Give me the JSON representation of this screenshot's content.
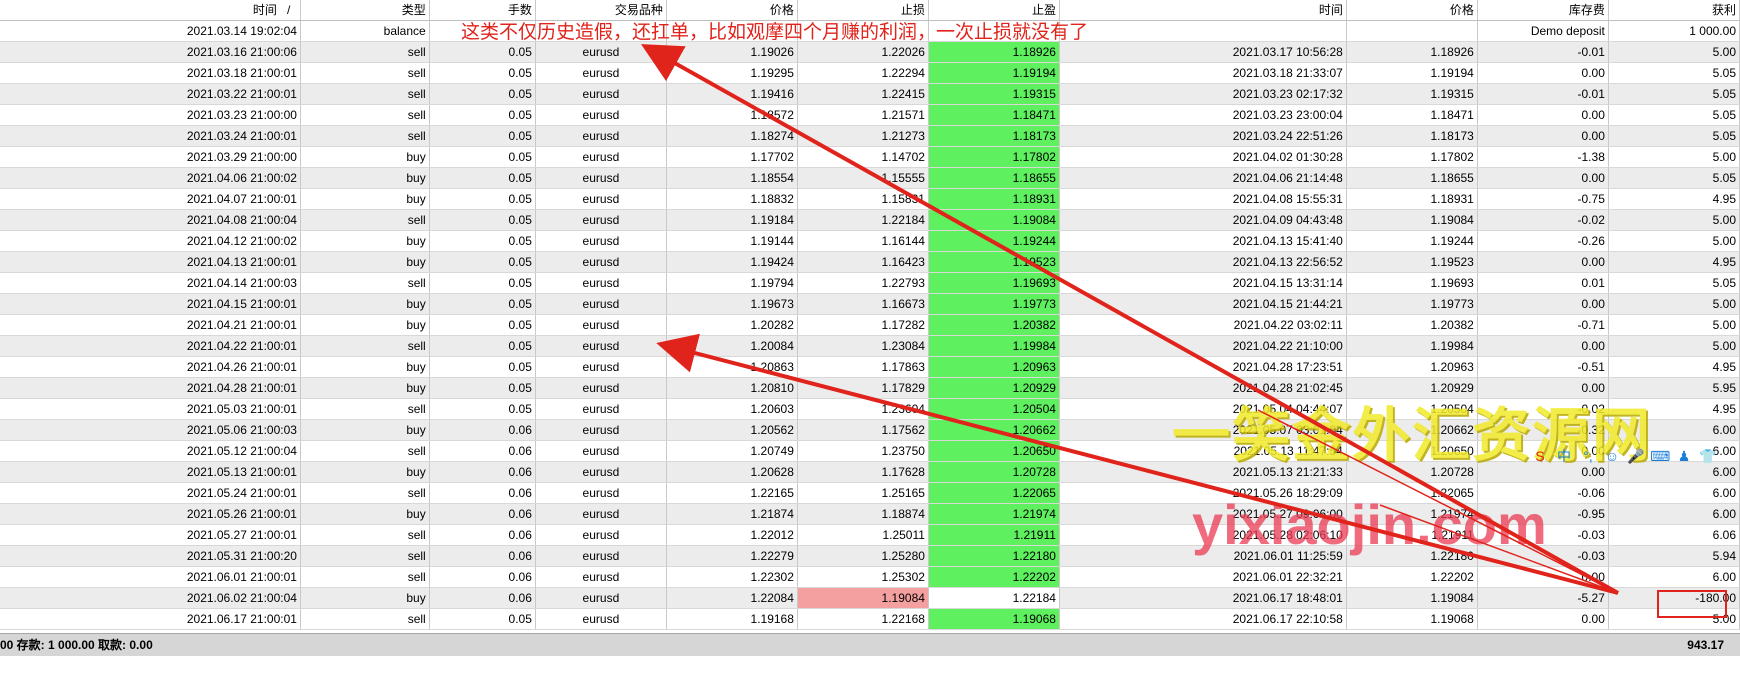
{
  "columns": [
    "时间",
    "类型",
    "手数",
    "交易品种",
    "价格",
    "止损",
    "止盈",
    "时间",
    "价格",
    "库存费",
    "获利"
  ],
  "sort_indicator": "/",
  "rows": [
    {
      "open_time": "2021.03.14 19:02:04",
      "type": "balance",
      "lots": "",
      "symbol": "",
      "open_price": "",
      "sl": "",
      "tp": "",
      "close_time": "",
      "close_price": "",
      "swap": "Demo deposit",
      "profit": "1 000.00"
    },
    {
      "open_time": "2021.03.16 21:00:06",
      "type": "sell",
      "lots": "0.05",
      "symbol": "eurusd",
      "open_price": "1.19026",
      "sl": "1.22026",
      "tp": "1.18926",
      "close_time": "2021.03.17 10:56:28",
      "close_price": "1.18926",
      "swap": "-0.01",
      "profit": "5.00"
    },
    {
      "open_time": "2021.03.18 21:00:01",
      "type": "sell",
      "lots": "0.05",
      "symbol": "eurusd",
      "open_price": "1.19295",
      "sl": "1.22294",
      "tp": "1.19194",
      "close_time": "2021.03.18 21:33:07",
      "close_price": "1.19194",
      "swap": "0.00",
      "profit": "5.05"
    },
    {
      "open_time": "2021.03.22 21:00:01",
      "type": "sell",
      "lots": "0.05",
      "symbol": "eurusd",
      "open_price": "1.19416",
      "sl": "1.22415",
      "tp": "1.19315",
      "close_time": "2021.03.23 02:17:32",
      "close_price": "1.19315",
      "swap": "-0.01",
      "profit": "5.05"
    },
    {
      "open_time": "2021.03.23 21:00:00",
      "type": "sell",
      "lots": "0.05",
      "symbol": "eurusd",
      "open_price": "1.18572",
      "sl": "1.21571",
      "tp": "1.18471",
      "close_time": "2021.03.23 23:00:04",
      "close_price": "1.18471",
      "swap": "0.00",
      "profit": "5.05"
    },
    {
      "open_time": "2021.03.24 21:00:01",
      "type": "sell",
      "lots": "0.05",
      "symbol": "eurusd",
      "open_price": "1.18274",
      "sl": "1.21273",
      "tp": "1.18173",
      "close_time": "2021.03.24 22:51:26",
      "close_price": "1.18173",
      "swap": "0.00",
      "profit": "5.05"
    },
    {
      "open_time": "2021.03.29 21:00:00",
      "type": "buy",
      "lots": "0.05",
      "symbol": "eurusd",
      "open_price": "1.17702",
      "sl": "1.14702",
      "tp": "1.17802",
      "close_time": "2021.04.02 01:30:28",
      "close_price": "1.17802",
      "swap": "-1.38",
      "profit": "5.00"
    },
    {
      "open_time": "2021.04.06 21:00:02",
      "type": "buy",
      "lots": "0.05",
      "symbol": "eurusd",
      "open_price": "1.18554",
      "sl": "1.15555",
      "tp": "1.18655",
      "close_time": "2021.04.06 21:14:48",
      "close_price": "1.18655",
      "swap": "0.00",
      "profit": "5.05"
    },
    {
      "open_time": "2021.04.07 21:00:01",
      "type": "buy",
      "lots": "0.05",
      "symbol": "eurusd",
      "open_price": "1.18832",
      "sl": "1.15831",
      "tp": "1.18931",
      "close_time": "2021.04.08 15:55:31",
      "close_price": "1.18931",
      "swap": "-0.75",
      "profit": "4.95"
    },
    {
      "open_time": "2021.04.08 21:00:04",
      "type": "sell",
      "lots": "0.05",
      "symbol": "eurusd",
      "open_price": "1.19184",
      "sl": "1.22184",
      "tp": "1.19084",
      "close_time": "2021.04.09 04:43:48",
      "close_price": "1.19084",
      "swap": "-0.02",
      "profit": "5.00"
    },
    {
      "open_time": "2021.04.12 21:00:02",
      "type": "buy",
      "lots": "0.05",
      "symbol": "eurusd",
      "open_price": "1.19144",
      "sl": "1.16144",
      "tp": "1.19244",
      "close_time": "2021.04.13 15:41:40",
      "close_price": "1.19244",
      "swap": "-0.26",
      "profit": "5.00"
    },
    {
      "open_time": "2021.04.13 21:00:01",
      "type": "buy",
      "lots": "0.05",
      "symbol": "eurusd",
      "open_price": "1.19424",
      "sl": "1.16423",
      "tp": "1.19523",
      "close_time": "2021.04.13 22:56:52",
      "close_price": "1.19523",
      "swap": "0.00",
      "profit": "4.95"
    },
    {
      "open_time": "2021.04.14 21:00:03",
      "type": "sell",
      "lots": "0.05",
      "symbol": "eurusd",
      "open_price": "1.19794",
      "sl": "1.22793",
      "tp": "1.19693",
      "close_time": "2021.04.15 13:31:14",
      "close_price": "1.19693",
      "swap": "0.01",
      "profit": "5.05"
    },
    {
      "open_time": "2021.04.15 21:00:01",
      "type": "buy",
      "lots": "0.05",
      "symbol": "eurusd",
      "open_price": "1.19673",
      "sl": "1.16673",
      "tp": "1.19773",
      "close_time": "2021.04.15 21:44:21",
      "close_price": "1.19773",
      "swap": "0.00",
      "profit": "5.00"
    },
    {
      "open_time": "2021.04.21 21:00:01",
      "type": "buy",
      "lots": "0.05",
      "symbol": "eurusd",
      "open_price": "1.20282",
      "sl": "1.17282",
      "tp": "1.20382",
      "close_time": "2021.04.22 03:02:11",
      "close_price": "1.20382",
      "swap": "-0.71",
      "profit": "5.00"
    },
    {
      "open_time": "2021.04.22 21:00:01",
      "type": "sell",
      "lots": "0.05",
      "symbol": "eurusd",
      "open_price": "1.20084",
      "sl": "1.23084",
      "tp": "1.19984",
      "close_time": "2021.04.22 21:10:00",
      "close_price": "1.19984",
      "swap": "0.00",
      "profit": "5.00"
    },
    {
      "open_time": "2021.04.26 21:00:01",
      "type": "buy",
      "lots": "0.05",
      "symbol": "eurusd",
      "open_price": "1.20863",
      "sl": "1.17863",
      "tp": "1.20963",
      "close_time": "2021.04.28 17:23:51",
      "close_price": "1.20963",
      "swap": "-0.51",
      "profit": "4.95"
    },
    {
      "open_time": "2021.04.28 21:00:01",
      "type": "buy",
      "lots": "0.05",
      "symbol": "eurusd",
      "open_price": "1.20810",
      "sl": "1.17829",
      "tp": "1.20929",
      "close_time": "2021.04.28 21:02:45",
      "close_price": "1.20929",
      "swap": "0.00",
      "profit": "5.95"
    },
    {
      "open_time": "2021.05.03 21:00:01",
      "type": "sell",
      "lots": "0.05",
      "symbol": "eurusd",
      "open_price": "1.20603",
      "sl": "1.23604",
      "tp": "1.20504",
      "close_time": "2021.05.04 04:44:07",
      "close_price": "1.20504",
      "swap": "-0.02",
      "profit": "4.95"
    },
    {
      "open_time": "2021.05.06 21:00:03",
      "type": "buy",
      "lots": "0.06",
      "symbol": "eurusd",
      "open_price": "1.20562",
      "sl": "1.17562",
      "tp": "1.20662",
      "close_time": "2021.05.07 03:01:04",
      "close_price": "1.20662",
      "swap": "-0.32",
      "profit": "6.00"
    },
    {
      "open_time": "2021.05.12 21:00:04",
      "type": "sell",
      "lots": "0.06",
      "symbol": "eurusd",
      "open_price": "1.20749",
      "sl": "1.23750",
      "tp": "1.20650",
      "close_time": "2021.05.13 11:47:54",
      "close_price": "1.20650",
      "swap": "0.00",
      "profit": "6.00"
    },
    {
      "open_time": "2021.05.13 21:00:01",
      "type": "buy",
      "lots": "0.06",
      "symbol": "eurusd",
      "open_price": "1.20628",
      "sl": "1.17628",
      "tp": "1.20728",
      "close_time": "2021.05.13 21:21:33",
      "close_price": "1.20728",
      "swap": "0.00",
      "profit": "6.00"
    },
    {
      "open_time": "2021.05.24 21:00:01",
      "type": "sell",
      "lots": "0.06",
      "symbol": "eurusd",
      "open_price": "1.22165",
      "sl": "1.25165",
      "tp": "1.22065",
      "close_time": "2021.05.26 18:29:09",
      "close_price": "1.22065",
      "swap": "-0.06",
      "profit": "6.00"
    },
    {
      "open_time": "2021.05.26 21:00:01",
      "type": "buy",
      "lots": "0.06",
      "symbol": "eurusd",
      "open_price": "1.21874",
      "sl": "1.18874",
      "tp": "1.21974",
      "close_time": "2021.05.27 09:06:00",
      "close_price": "1.21974",
      "swap": "-0.95",
      "profit": "6.00"
    },
    {
      "open_time": "2021.05.27 21:00:01",
      "type": "sell",
      "lots": "0.06",
      "symbol": "eurusd",
      "open_price": "1.22012",
      "sl": "1.25011",
      "tp": "1.21911",
      "close_time": "2021.05.28 02:06:10",
      "close_price": "1.21911",
      "swap": "-0.03",
      "profit": "6.06"
    },
    {
      "open_time": "2021.05.31 21:00:20",
      "type": "sell",
      "lots": "0.06",
      "symbol": "eurusd",
      "open_price": "1.22279",
      "sl": "1.25280",
      "tp": "1.22180",
      "close_time": "2021.06.01 11:25:59",
      "close_price": "1.22180",
      "swap": "-0.03",
      "profit": "5.94"
    },
    {
      "open_time": "2021.06.01 21:00:01",
      "type": "sell",
      "lots": "0.06",
      "symbol": "eurusd",
      "open_price": "1.22302",
      "sl": "1.25302",
      "tp": "1.22202",
      "close_time": "2021.06.01 22:32:21",
      "close_price": "1.22202",
      "swap": "0.00",
      "profit": "6.00"
    },
    {
      "open_time": "2021.06.02 21:00:04",
      "type": "buy",
      "lots": "0.06",
      "symbol": "eurusd",
      "open_price": "1.22084",
      "sl": "1.19084",
      "tp": "1.22184",
      "close_time": "2021.06.17 18:48:01",
      "close_price": "1.19084",
      "swap": "-5.27",
      "profit": "-180.00"
    },
    {
      "open_time": "2021.06.17 21:00:01",
      "type": "sell",
      "lots": "0.05",
      "symbol": "eurusd",
      "open_price": "1.19168",
      "sl": "1.22168",
      "tp": "1.19068",
      "close_time": "2021.06.17 22:10:58",
      "close_price": "1.19068",
      "swap": "0.00",
      "profit": "5.00"
    }
  ],
  "footer": {
    "summary": "00  存款: 1 000.00  取款: 0.00",
    "total": "943.17"
  },
  "annotation": {
    "text": "这类不仅历史造假，还扛单，比如观摩四个月赚的利润，一次止损就没有了",
    "color": "#e0231b"
  },
  "watermark": {
    "line1": "一笑金外汇资源网",
    "line2": "yixiaojin.com"
  },
  "colors": {
    "tp_cell": "#5ff05f",
    "sl_hit_cell": "#f5a0a0",
    "row_alt": "#ececec"
  }
}
